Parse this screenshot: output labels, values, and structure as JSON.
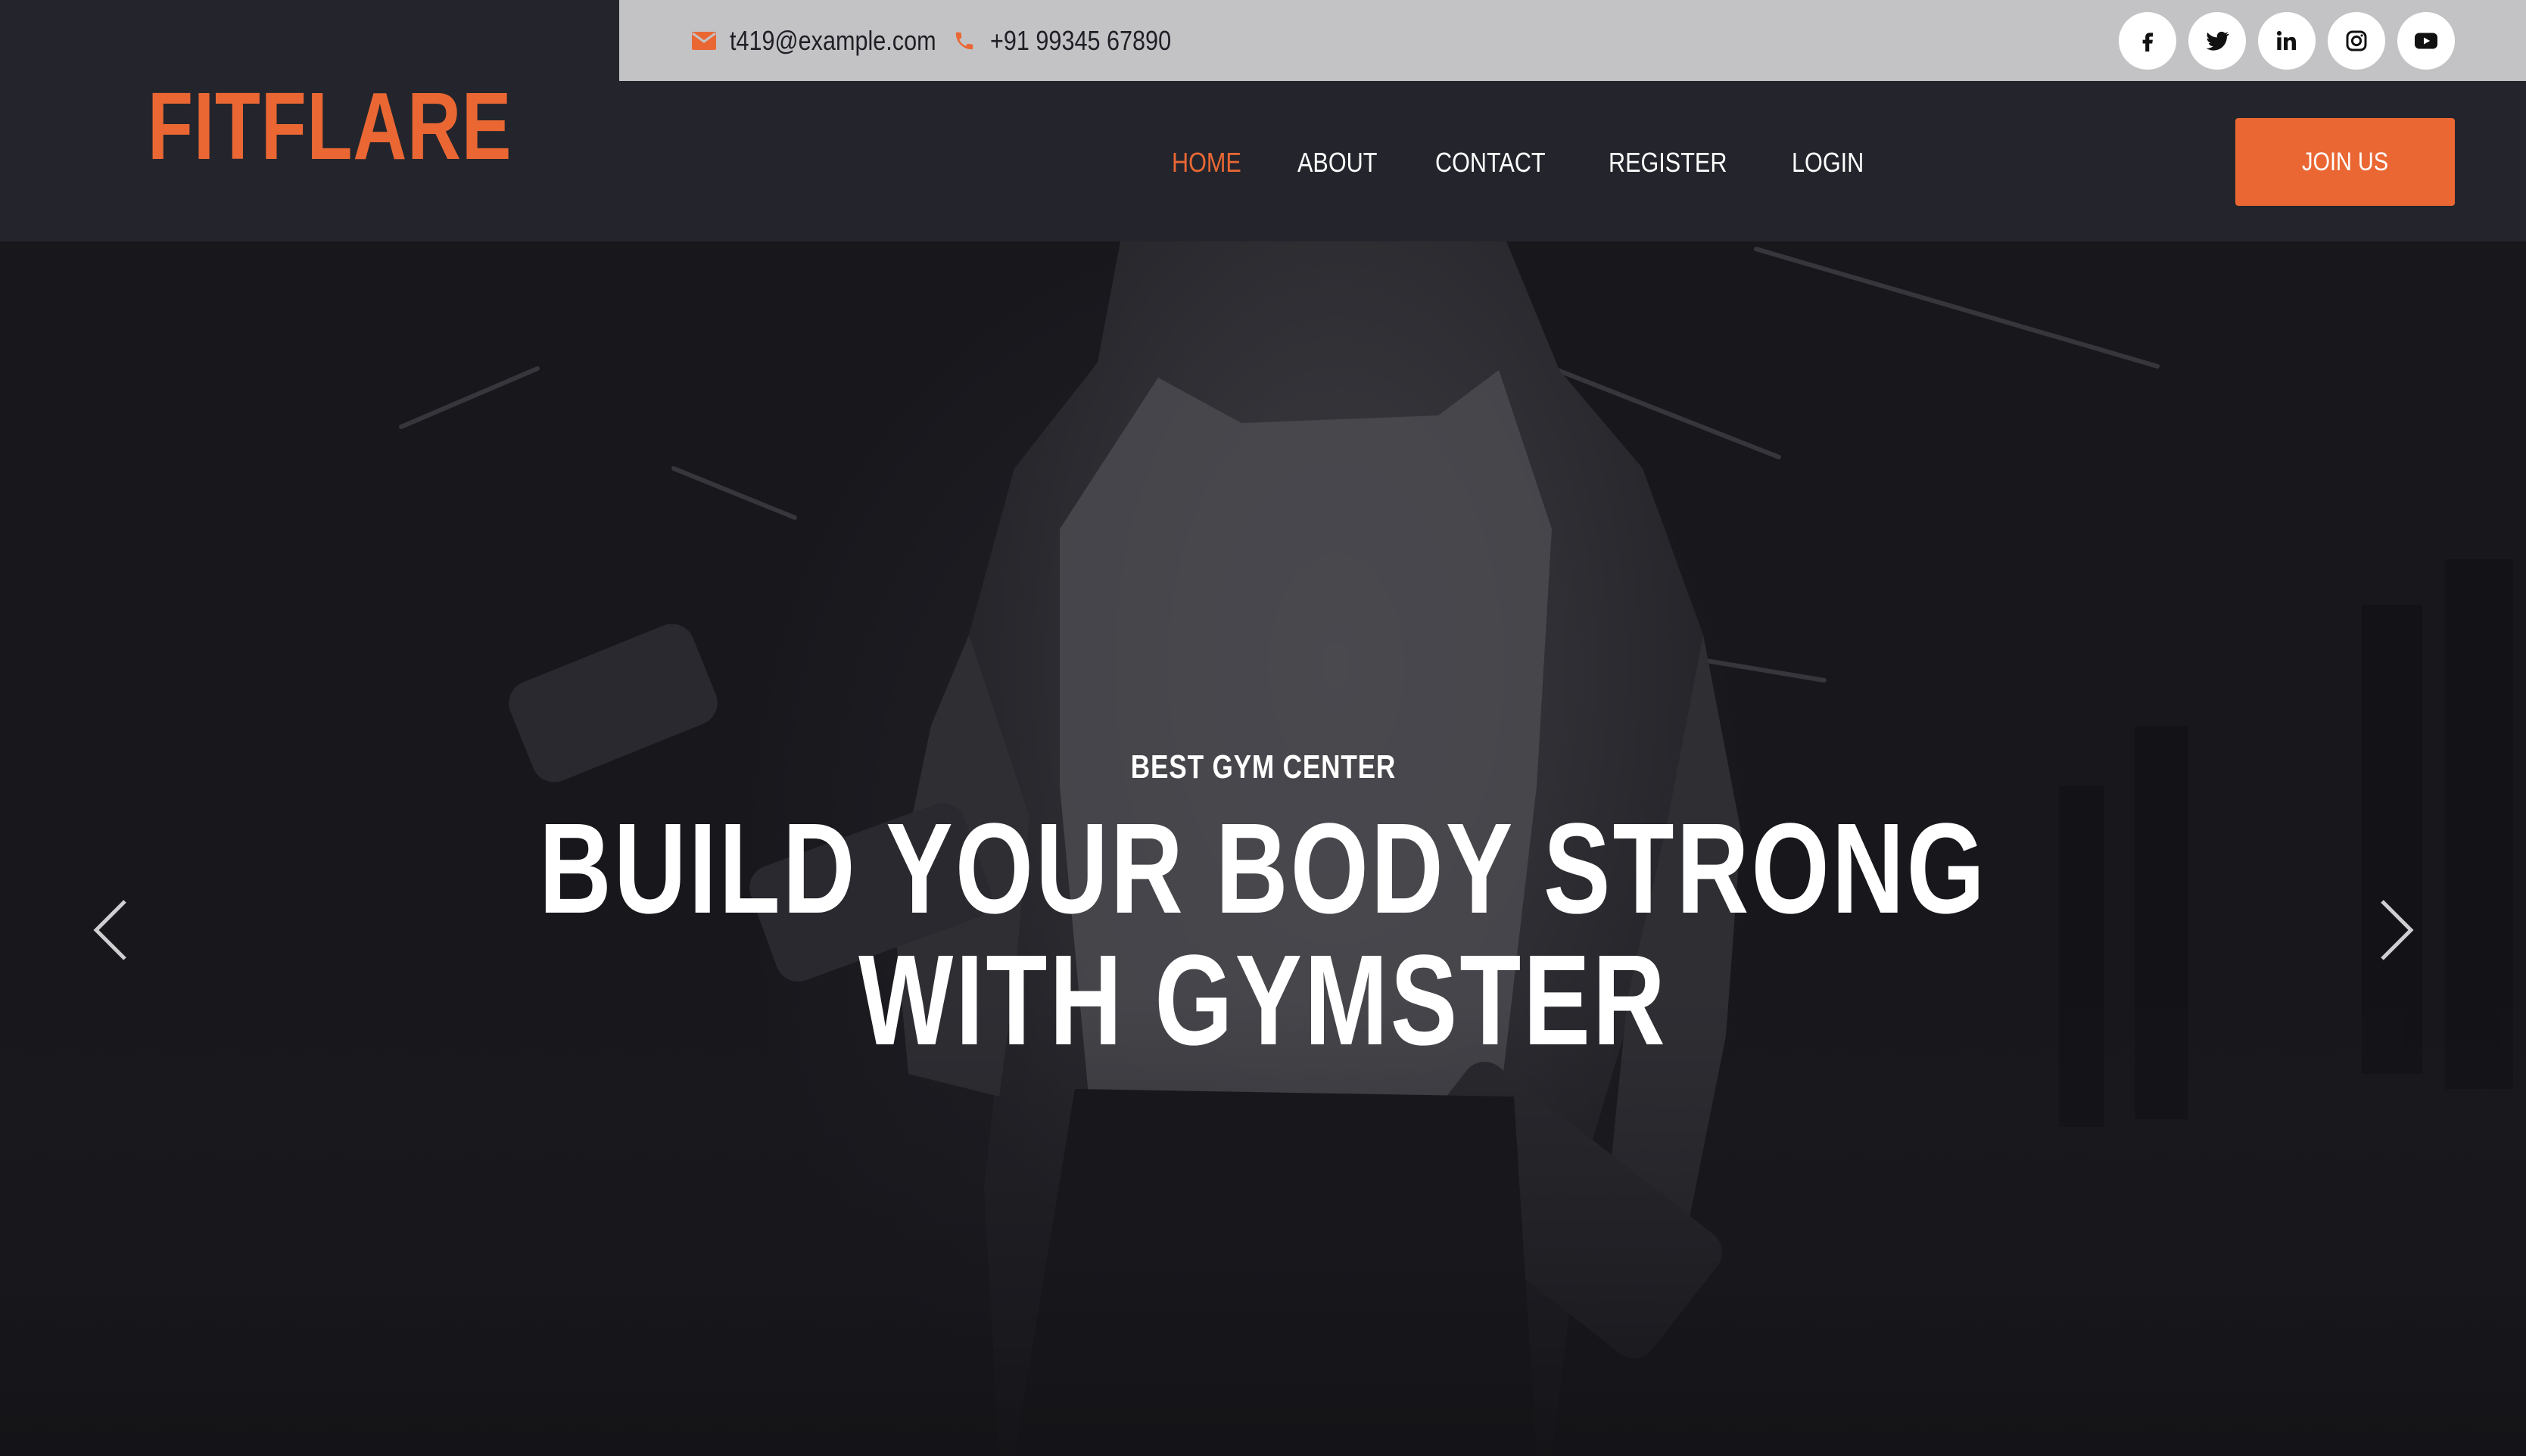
{
  "brand": {
    "logo_text": "FITFLARE",
    "accent_color": "#ea6734"
  },
  "topbar": {
    "email": "t419@example.com",
    "email_icon": "envelope-icon",
    "phone": "+91 99345 67890",
    "phone_icon": "phone-icon",
    "social": [
      "facebook-icon",
      "twitter-icon",
      "linkedin-icon",
      "instagram-icon",
      "youtube-icon"
    ]
  },
  "nav": {
    "items": [
      {
        "label": "HOME",
        "active": true
      },
      {
        "label": "ABOUT",
        "active": false
      },
      {
        "label": "CONTACT",
        "active": false
      },
      {
        "label": "REGISTER",
        "active": false
      },
      {
        "label": "LOGIN",
        "active": false
      }
    ],
    "cta_label": "JOIN US"
  },
  "hero": {
    "subtitle": "BEST GYM CENTER",
    "title_line1": "BUILD YOUR BODY STRONG",
    "title_line2": "WITH GYMSTER",
    "prev_icon": "chevron-left-icon",
    "next_icon": "chevron-right-icon"
  }
}
